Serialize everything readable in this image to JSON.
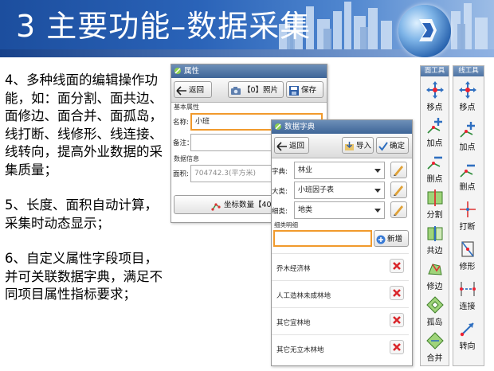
{
  "banner": {
    "title": "3 主要功能–数据采集"
  },
  "description": {
    "p1": "4、多种线面的编辑操作功能，如：面分割、面共边、面修边、面合并、面孤岛，线打断、线修形、线连接、线转向，提高外业数据的采集质量；",
    "p2": "5、长度、面积自动计算，采集时动态显示；",
    "p3": "6、自定义属性字段项目，并可关联数据字典，满足不同项目属性指标要求；"
  },
  "attr_window": {
    "title": "属性",
    "back_label": "返回",
    "photo_label": "【0】照片",
    "save_label": "保存",
    "section_basic": "基本属性",
    "name_label": "名称:",
    "name_value": "小班",
    "remark_label": "备注：",
    "section_data": "数据信息",
    "area_label": "面积:",
    "area_value": "704742.3(平方米)",
    "coord_label": "坐标数量【40"
  },
  "dict_window": {
    "title": "数据字典",
    "back_label": "返回",
    "import_label": "导入",
    "confirm_label": "确定",
    "dict_label": "字典:",
    "dict_value": "林业",
    "major_label": "大类:",
    "major_value": "小班因子表",
    "minor_label": "细类:",
    "minor_value": "地类",
    "detail_label": "细类明细",
    "add_label": "新增",
    "items": [
      "乔木经济林",
      "人工造林未成林地",
      "其它宜林地",
      "其它无立木林地"
    ]
  },
  "face_tools": {
    "title": "面工具",
    "items": [
      "移点",
      "加点",
      "删点",
      "分割",
      "共边",
      "修边",
      "孤岛",
      "合并"
    ]
  },
  "line_tools": {
    "title": "线工具",
    "items": [
      "移点",
      "加点",
      "删点",
      "打断",
      "修形",
      "连接",
      "转向"
    ]
  },
  "colors": {
    "banner_blue": "#2a63b8",
    "accent_orange": "#f19a2c",
    "delete_red": "#d9262b"
  }
}
